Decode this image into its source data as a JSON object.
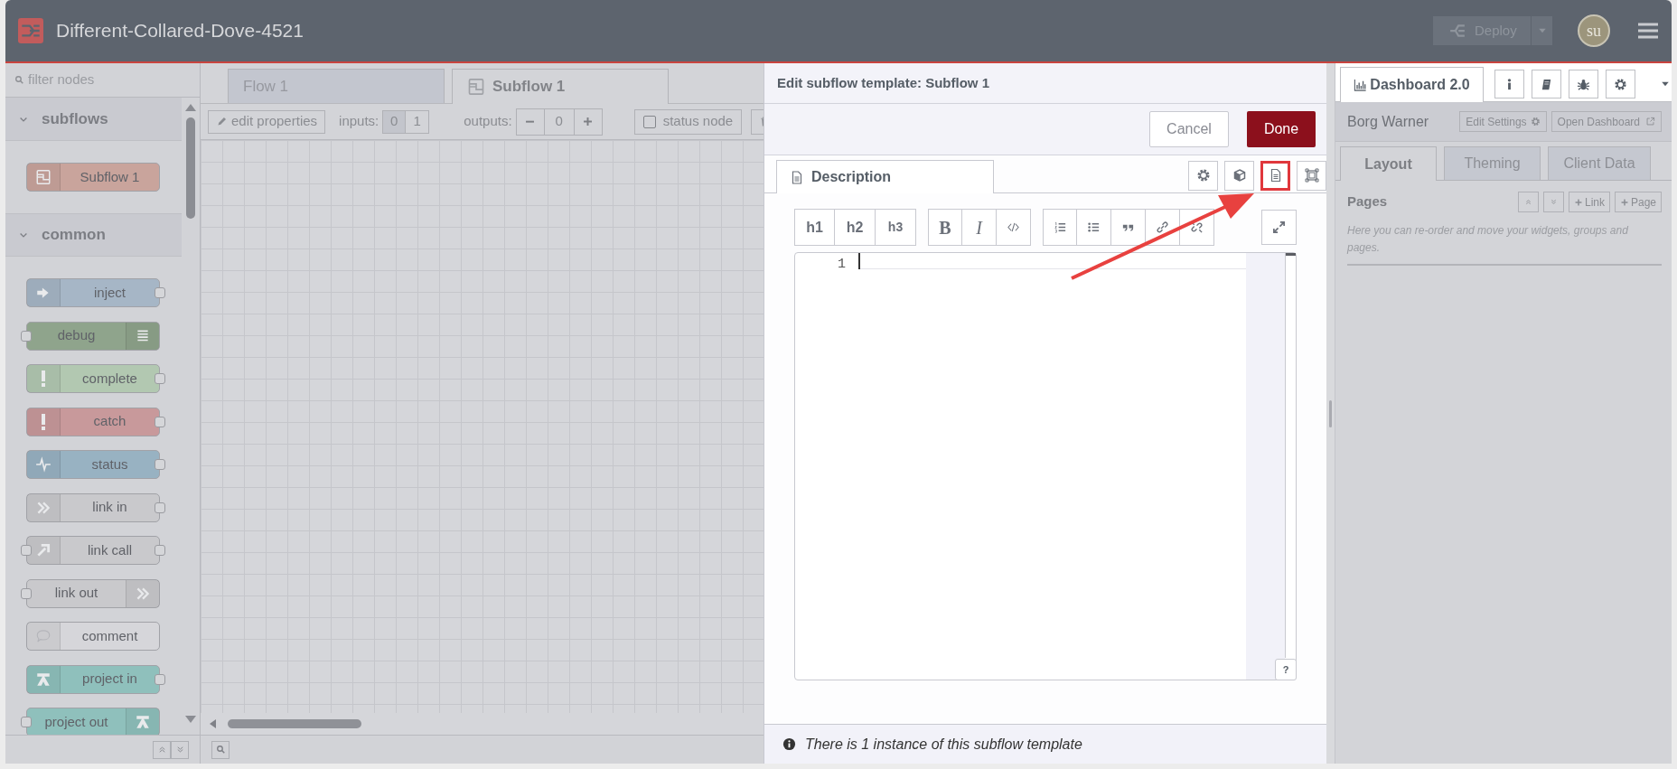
{
  "header": {
    "title": "Different-Collared-Dove-4521",
    "deploy": "Deploy",
    "avatar": "su"
  },
  "palette": {
    "filter_placeholder": "filter nodes",
    "categories": [
      {
        "label": "subflows",
        "expanded": true,
        "nodes": [
          {
            "label": "Subflow 1",
            "kind": "subflow",
            "color": "#c9a49c",
            "input": false,
            "output": false
          }
        ]
      },
      {
        "label": "common",
        "expanded": true,
        "nodes": [
          {
            "label": "inject",
            "kind": "inject",
            "color": "#a6b6c6",
            "input": false,
            "output": true
          },
          {
            "label": "debug",
            "kind": "debug",
            "color": "#8fa48c",
            "input": true,
            "output": false
          },
          {
            "label": "complete",
            "kind": "alert",
            "color": "#b2c8b1",
            "input": false,
            "output": true
          },
          {
            "label": "catch",
            "kind": "alert",
            "color": "#c8999b",
            "input": false,
            "output": true
          },
          {
            "label": "status",
            "kind": "pulse",
            "color": "#98b2c2",
            "input": false,
            "output": true
          },
          {
            "label": "link in",
            "kind": "link",
            "color": "#c9c9cc",
            "input": false,
            "output": true
          },
          {
            "label": "link call",
            "kind": "link-call",
            "color": "#c9c9cc",
            "input": true,
            "output": true
          },
          {
            "label": "link out",
            "kind": "link",
            "color": "#c9c9cc",
            "input": true,
            "output": false
          },
          {
            "label": "comment",
            "kind": "comment",
            "color": "#d6d6da",
            "input": false,
            "output": false
          },
          {
            "label": "project in",
            "kind": "project",
            "color": "#8fc0bc",
            "input": false,
            "output": true
          },
          {
            "label": "project out",
            "kind": "project",
            "color": "#8fc0bc",
            "input": true,
            "output": false
          }
        ]
      }
    ]
  },
  "workspace": {
    "tabs": [
      {
        "label": "Flow 1",
        "selected": false
      },
      {
        "label": "Subflow 1",
        "selected": true
      }
    ],
    "toolbar": {
      "edit_properties": "edit properties",
      "inputs_label": "inputs:",
      "inputs": [
        {
          "label": "0",
          "selected": true
        },
        {
          "label": "1",
          "selected": false
        }
      ],
      "outputs_label": "outputs:",
      "outputs_value": "0",
      "status_node": {
        "label": "status node",
        "checked": false
      }
    }
  },
  "editor": {
    "title": "Edit subflow template: Subflow 1",
    "cancel": "Cancel",
    "done": "Done",
    "tab": {
      "label": "Description",
      "selected": true
    },
    "side_buttons": [
      {
        "kind": "settings",
        "highlighted": false
      },
      {
        "kind": "cube",
        "highlighted": false
      },
      {
        "kind": "document",
        "highlighted": true
      },
      {
        "kind": "frame",
        "highlighted": false
      }
    ],
    "markdown_toolbar": [
      [
        {
          "kind": "heading",
          "label": "h1"
        },
        {
          "kind": "heading",
          "label": "h2"
        },
        {
          "kind": "heading-small",
          "label": "h3"
        }
      ],
      [
        {
          "kind": "bold",
          "label": "B"
        },
        {
          "kind": "italic",
          "label": "I"
        },
        {
          "kind": "code"
        }
      ],
      [
        {
          "kind": "ordered-list"
        },
        {
          "kind": "bullet-list"
        },
        {
          "kind": "quote"
        },
        {
          "kind": "link"
        },
        {
          "kind": "unlink"
        }
      ]
    ],
    "line_numbers": [
      "1"
    ],
    "help": "?",
    "footer": "There is 1 instance of this subflow template"
  },
  "sidebar": {
    "tab": {
      "label": "Dashboard 2.0",
      "selected": true
    },
    "icon_buttons": [
      {
        "kind": "info"
      },
      {
        "kind": "book"
      },
      {
        "kind": "bug"
      },
      {
        "kind": "settings"
      }
    ],
    "dashboard_name": "Borg Warner",
    "edit_settings": "Edit Settings",
    "open_dashboard": "Open Dashboard",
    "tabs": [
      {
        "label": "Layout",
        "selected": true
      },
      {
        "label": "Theming",
        "selected": false
      },
      {
        "label": "Client Data",
        "selected": false
      }
    ],
    "pages": {
      "title": "Pages",
      "link": "Link",
      "page": "Page",
      "hint": "Here you can re-order and move your widgets, groups and pages."
    }
  }
}
